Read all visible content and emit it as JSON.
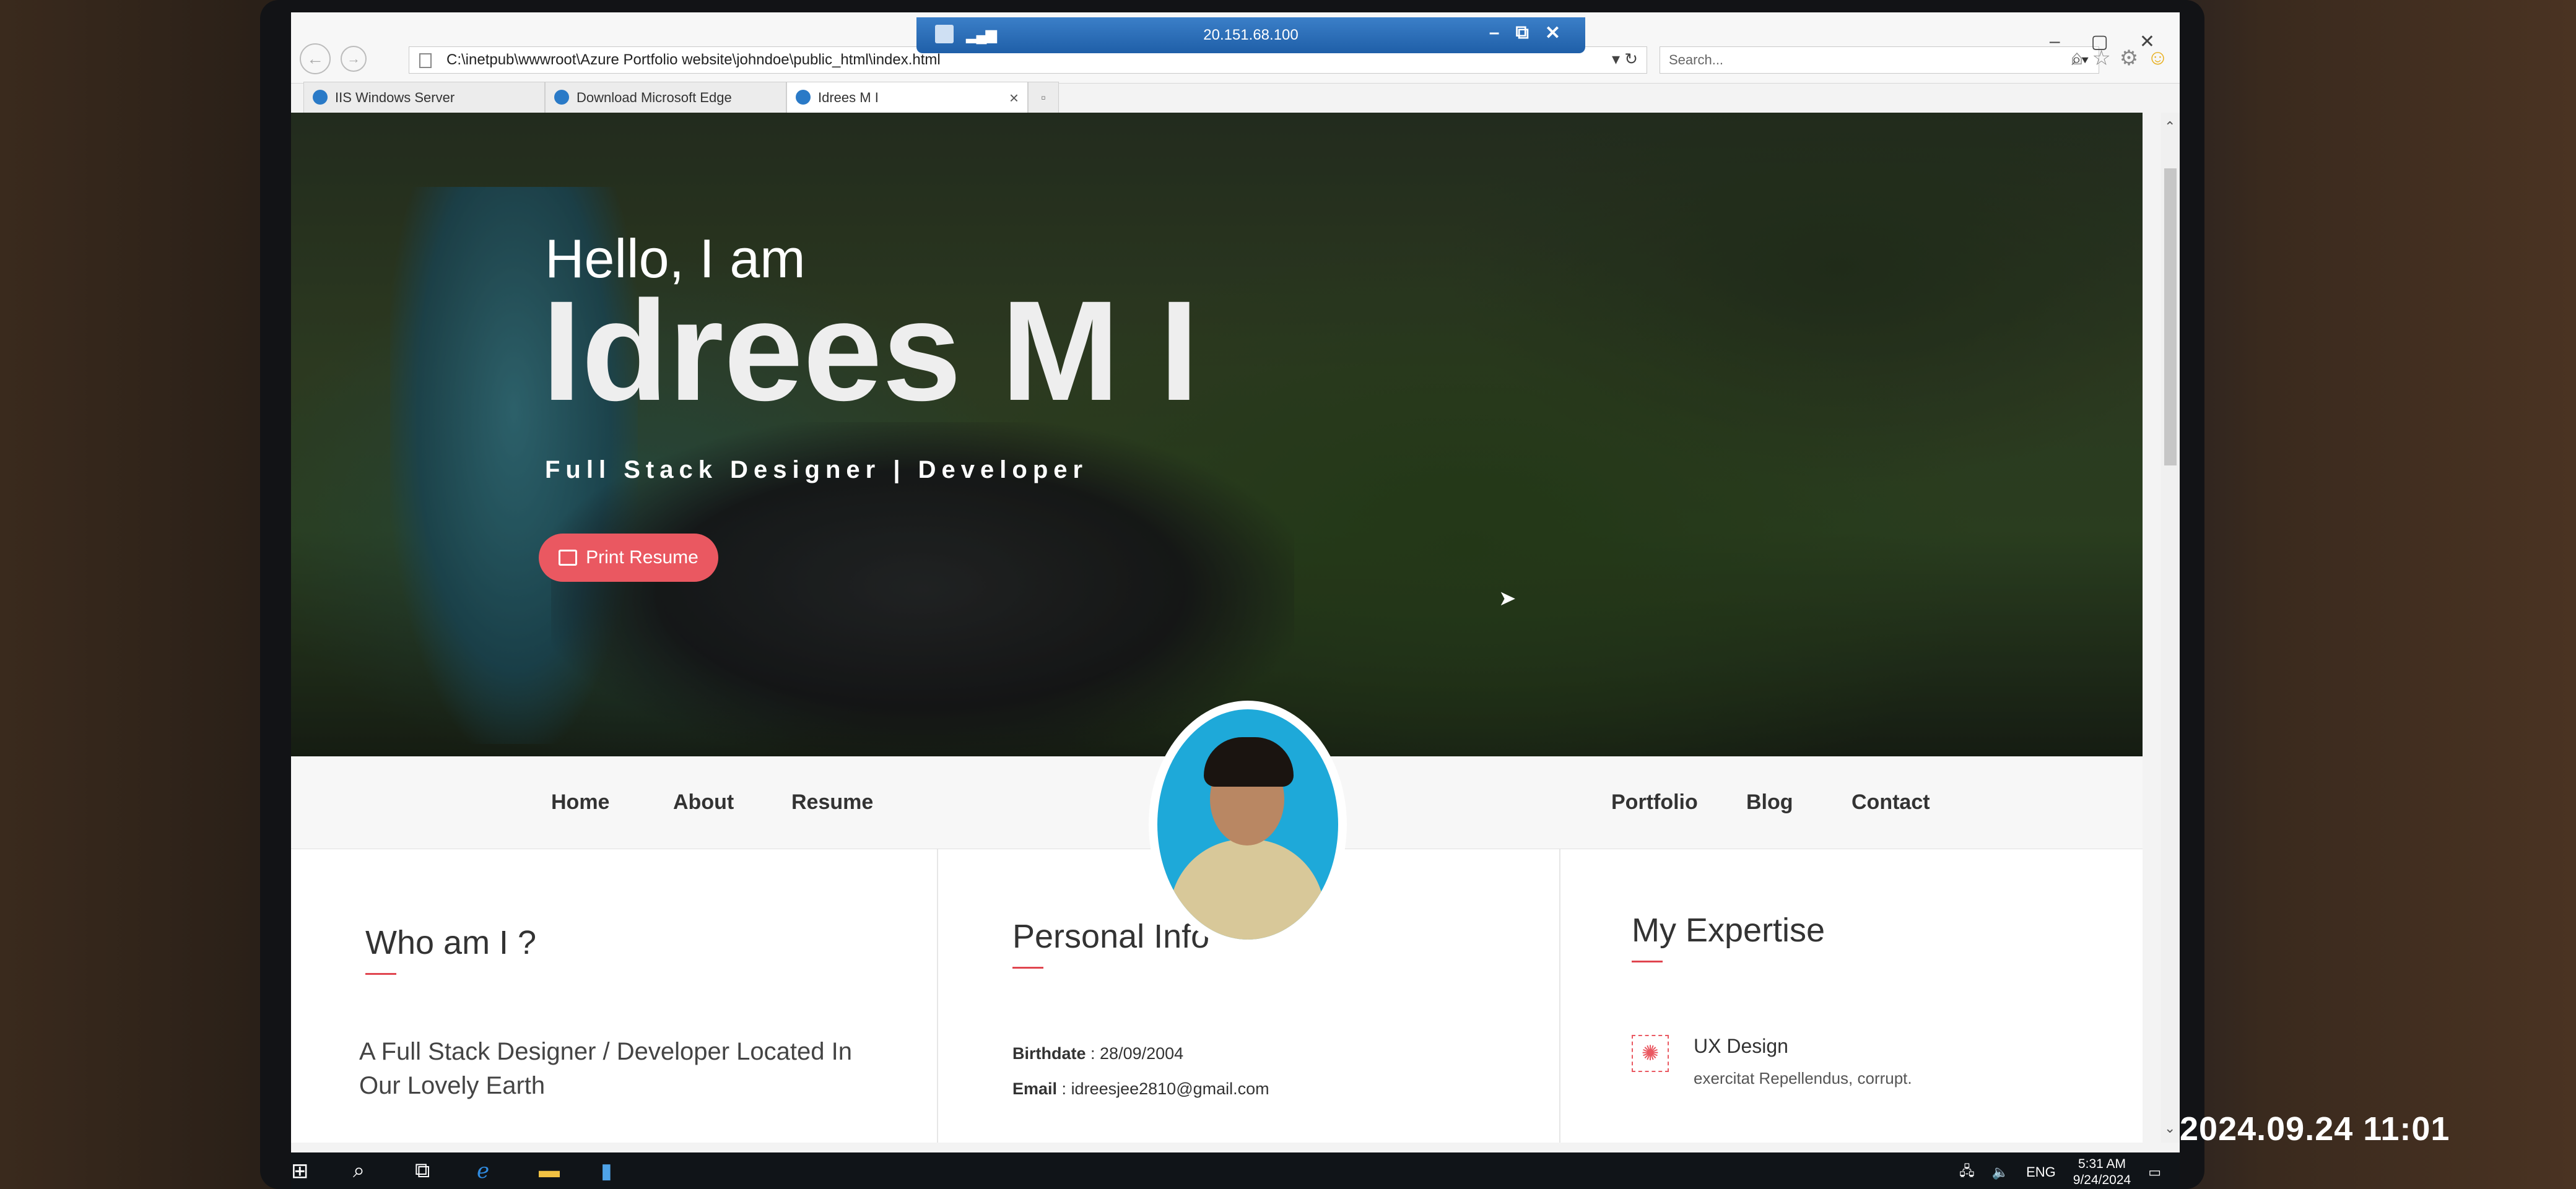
{
  "rdp": {
    "host": "20.151.68.100",
    "signal": "▂▄▆",
    "minimize": "–",
    "restore": "⧉",
    "close": "✕"
  },
  "browser": {
    "address": "C:\\inetpub\\wwwroot\\Azure Portfolio website\\johndoe\\public_html\\index.html",
    "search_placeholder": "Search...",
    "tabs": [
      {
        "label": "IIS Windows Server"
      },
      {
        "label": "Download Microsoft Edge"
      },
      {
        "label": "Idrees M I"
      }
    ]
  },
  "hero": {
    "greeting": "Hello, I am",
    "name": "Idrees M I",
    "role": "Full Stack Designer | Developer",
    "print_button": "Print Resume"
  },
  "nav": {
    "left": [
      "Home",
      "About",
      "Resume"
    ],
    "right": [
      "Portfolio",
      "Blog",
      "Contact"
    ]
  },
  "who": {
    "title": "Who am I ?",
    "text": "A Full Stack Designer / Developer Located In Our Lovely Earth"
  },
  "personal": {
    "title": "Personal Info",
    "birthdate_label": "Birthdate",
    "birthdate": "28/09/2004",
    "email_label": "Email",
    "email": "idreesjee2810@gmail.com"
  },
  "expertise": {
    "title": "My Expertise",
    "items": [
      {
        "title": "UX Design",
        "desc": "exercitat Repellendus, corrupt."
      }
    ]
  },
  "taskbar": {
    "lang": "ENG",
    "time": "5:31 AM",
    "date": "9/24/2024"
  },
  "camera_stamp": "2024.09.24 11:01"
}
